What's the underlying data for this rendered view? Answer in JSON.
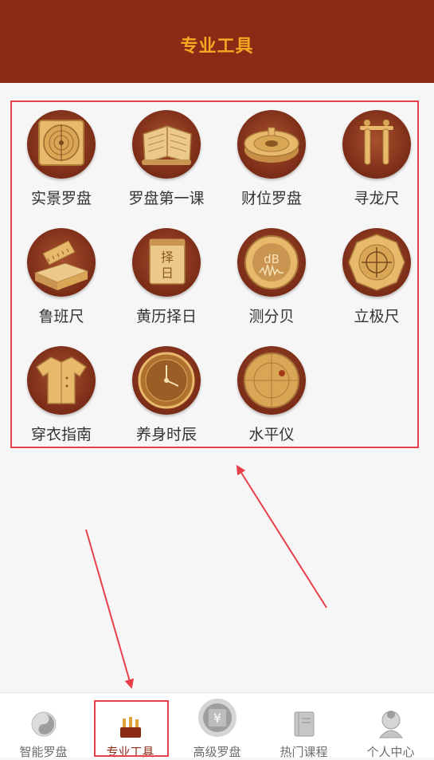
{
  "header": {
    "title": "专业工具"
  },
  "tools": [
    {
      "label": "实景罗盘",
      "icon": "compass-square-icon"
    },
    {
      "label": "罗盘第一课",
      "icon": "scroll-book-icon"
    },
    {
      "label": "财位罗盘",
      "icon": "wealth-compass-icon"
    },
    {
      "label": "寻龙尺",
      "icon": "dowsing-rod-icon"
    },
    {
      "label": "鲁班尺",
      "icon": "ruler-box-icon"
    },
    {
      "label": "黄历择日",
      "icon": "calendar-icon"
    },
    {
      "label": "测分贝",
      "icon": "decibel-meter-icon"
    },
    {
      "label": "立极尺",
      "icon": "crosshair-compass-icon"
    },
    {
      "label": "穿衣指南",
      "icon": "clothing-icon"
    },
    {
      "label": "养身时辰",
      "icon": "clock-icon"
    },
    {
      "label": "水平仪",
      "icon": "level-meter-icon"
    }
  ],
  "tabbar": {
    "tabs": [
      {
        "label": "智能罗盘",
        "icon": "yin-yang-icon",
        "active": false
      },
      {
        "label": "专业工具",
        "icon": "toolbox-icon",
        "active": true
      },
      {
        "label": "高级罗盘",
        "icon": "yuan-coin-icon",
        "active": false
      },
      {
        "label": "热门课程",
        "icon": "book-icon",
        "active": false
      },
      {
        "label": "个人中心",
        "icon": "avatar-icon",
        "active": false
      }
    ]
  },
  "colors": {
    "header_bg": "#8b2b16",
    "header_text": "#f5a623",
    "annotation_red": "#e8404a",
    "icon_gold": "#e8b96a"
  }
}
